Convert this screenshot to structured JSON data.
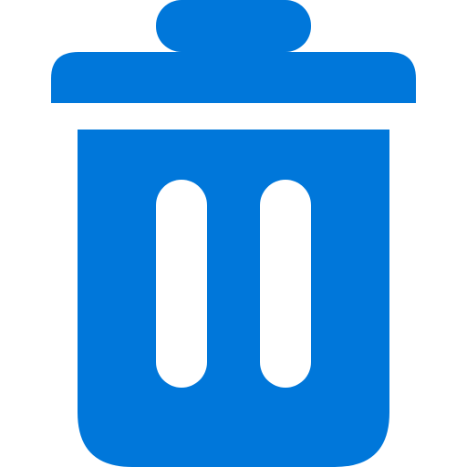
{
  "icon": {
    "name": "trash-can-icon",
    "color": "#0077DA",
    "background": "#FFFFFF"
  }
}
